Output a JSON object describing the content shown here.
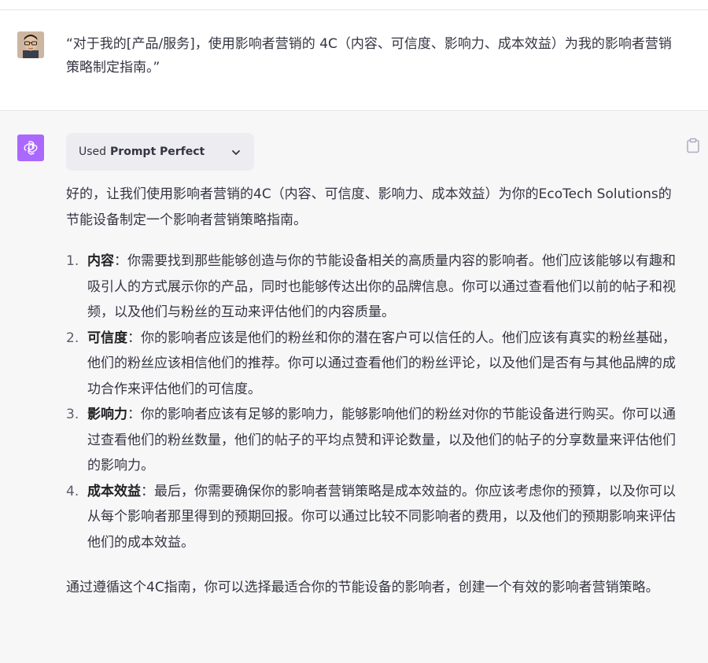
{
  "user_message": {
    "text": "“对于我的[产品/服务]，使用影响者营销的 4C（内容、可信度、影响力、成本效益）为我的影响者营销策略制定指南。”"
  },
  "assistant_message": {
    "plugin": {
      "used_label": "Used",
      "plugin_name": "Prompt Perfect",
      "chevron_icon": "chevron-down-icon"
    },
    "intro": "好的，让我们使用影响者营销的4C（内容、可信度、影响力、成本效益）为你的EcoTech Solutions的节能设备制定一个影响者营销策略指南。",
    "items": [
      {
        "number": "1.",
        "title": "内容",
        "text": "：你需要找到那些能够创造与你的节能设备相关的高质量内容的影响者。他们应该能够以有趣和吸引人的方式展示你的产品，同时也能够传达出你的品牌信息。你可以通过查看他们以前的帖子和视频，以及他们与粉丝的互动来评估他们的内容质量。"
      },
      {
        "number": "2.",
        "title": "可信度",
        "text": "：你的影响者应该是他们的粉丝和你的潜在客户可以信任的人。他们应该有真实的粉丝基础，他们的粉丝应该相信他们的推荐。你可以通过查看他们的粉丝评论，以及他们是否有与其他品牌的成功合作来评估他们的可信度。"
      },
      {
        "number": "3.",
        "title": "影响力",
        "text": "：你的影响者应该有足够的影响力，能够影响他们的粉丝对你的节能设备进行购买。你可以通过查看他们的粉丝数量，他们的帖子的平均点赞和评论数量，以及他们的帖子的分享数量来评估他们的影响力。"
      },
      {
        "number": "4.",
        "title": "成本效益",
        "text": "：最后，你需要确保你的影响者营销策略是成本效益的。你应该考虑你的预算，以及你可以从每个影响者那里得到的预期回报。你可以通过比较不同影响者的费用，以及他们的预期影响来评估他们的成本效益。"
      }
    ],
    "conclusion": "通过遵循这个4C指南，你可以选择最适合你的节能设备的影响者，创建一个有效的影响者营销策略。"
  },
  "colors": {
    "assistant_avatar_bg": "#ab68ff",
    "assistant_bg": "#f7f7f8",
    "text": "#343541",
    "plugin_pill_bg": "#ececf1"
  }
}
